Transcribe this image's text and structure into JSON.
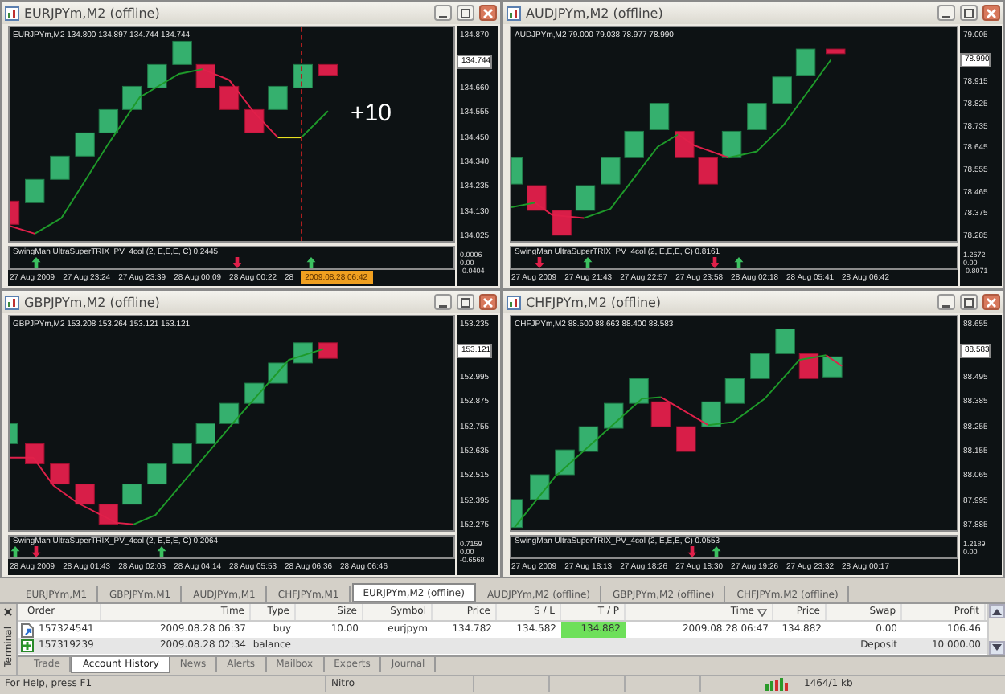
{
  "windows": [
    {
      "title": "EURJPYm,M2 (offline)",
      "info": "EURJPYm,M2  134.800 134.897 134.744 134.744",
      "annotation": "+10",
      "prices": [
        {
          "text": "134.870",
          "current": false
        },
        {
          "text": "134.744",
          "current": true
        },
        {
          "text": "134.660",
          "current": false
        },
        {
          "text": "134.555",
          "current": false
        },
        {
          "text": "134.450",
          "current": false
        },
        {
          "text": "134.340",
          "current": false
        },
        {
          "text": "134.235",
          "current": false
        },
        {
          "text": "134.130",
          "current": false
        },
        {
          "text": "134.025",
          "current": false
        }
      ],
      "indicator": "SwingMan UltraSuperTRIX_PV_4col (2, E,E,E, C) 0.2445",
      "indicator_scale": [
        "0.0006",
        "0.00",
        "-0.0404"
      ],
      "times": [
        "27 Aug 2009",
        "27 Aug 23:24",
        "27 Aug 23:39",
        "28 Aug 00:09",
        "28 Aug 00:22",
        "28"
      ],
      "cursor_time": "2009.08.28 06:42"
    },
    {
      "title": "AUDJPYm,M2 (offline)",
      "info": "AUDJPYm,M2  79.000 79.038 78.977 78.990",
      "prices": [
        {
          "text": "79.005",
          "current": false
        },
        {
          "text": "78.990",
          "current": true
        },
        {
          "text": "78.915",
          "current": false
        },
        {
          "text": "78.825",
          "current": false
        },
        {
          "text": "78.735",
          "current": false
        },
        {
          "text": "78.645",
          "current": false
        },
        {
          "text": "78.555",
          "current": false
        },
        {
          "text": "78.465",
          "current": false
        },
        {
          "text": "78.375",
          "current": false
        },
        {
          "text": "78.285",
          "current": false
        }
      ],
      "indicator": "SwingMan UltraSuperTRIX_PV_4col (2, E,E,E, C) 0.8161",
      "indicator_scale": [
        "1.2672",
        "0.00",
        "-0.8071"
      ],
      "times": [
        "27 Aug 2009",
        "27 Aug 21:43",
        "27 Aug 22:57",
        "27 Aug 23:58",
        "28 Aug 02:18",
        "28 Aug 05:41",
        "28 Aug 06:42"
      ]
    },
    {
      "title": "GBPJPYm,M2 (offline)",
      "info": "GBPJPYm,M2  153.208 153.264 153.121 153.121",
      "prices": [
        {
          "text": "153.235",
          "current": false
        },
        {
          "text": "153.121",
          "current": true
        },
        {
          "text": "152.995",
          "current": false
        },
        {
          "text": "152.875",
          "current": false
        },
        {
          "text": "152.755",
          "current": false
        },
        {
          "text": "152.635",
          "current": false
        },
        {
          "text": "152.515",
          "current": false
        },
        {
          "text": "152.395",
          "current": false
        },
        {
          "text": "152.275",
          "current": false
        }
      ],
      "indicator": "SwingMan UltraSuperTRIX_PV_4col (2, E,E,E, C) 0.2064",
      "indicator_scale": [
        "0.7159",
        "0.00",
        "-0.6568"
      ],
      "times": [
        "28 Aug 2009",
        "28 Aug 01:43",
        "28 Aug 02:03",
        "28 Aug 04:14",
        "28 Aug 05:53",
        "28 Aug 06:36",
        "28 Aug 06:46"
      ]
    },
    {
      "title": "CHFJPYm,M2 (offline)",
      "info": "CHFJPYm,M2  88.500 88.663 88.400 88.583",
      "prices": [
        {
          "text": "88.655",
          "current": false
        },
        {
          "text": "88.583",
          "current": true
        },
        {
          "text": "88.495",
          "current": false
        },
        {
          "text": "88.385",
          "current": false
        },
        {
          "text": "88.255",
          "current": false
        },
        {
          "text": "88.155",
          "current": false
        },
        {
          "text": "88.065",
          "current": false
        },
        {
          "text": "87.995",
          "current": false
        },
        {
          "text": "87.885",
          "current": false
        }
      ],
      "indicator": "SwingMan UltraSuperTRIX_PV_4col (2, E,E,E, C) 0.0553",
      "indicator_scale": [
        "1.2189",
        "0.00"
      ],
      "times": [
        "27 Aug 2009",
        "27 Aug 18:13",
        "27 Aug 18:26",
        "27 Aug 18:30",
        "27 Aug 19:26",
        "27 Aug 23:32",
        "28 Aug 00:17"
      ]
    }
  ],
  "chart_tabs": [
    {
      "label": "EURJPYm,M1",
      "selected": false
    },
    {
      "label": "GBPJPYm,M1",
      "selected": false
    },
    {
      "label": "AUDJPYm,M1",
      "selected": false
    },
    {
      "label": "CHFJPYm,M1",
      "selected": false
    },
    {
      "label": "EURJPYm,M2 (offline)",
      "selected": true
    },
    {
      "label": "AUDJPYm,M2 (offline)",
      "selected": false
    },
    {
      "label": "GBPJPYm,M2 (offline)",
      "selected": false
    },
    {
      "label": "CHFJPYm,M2 (offline)",
      "selected": false
    }
  ],
  "terminal": {
    "label": "Terminal",
    "columns": [
      {
        "label": "Order",
        "sorted": false
      },
      {
        "label": "Time",
        "sorted": false
      },
      {
        "label": "Type",
        "sorted": false
      },
      {
        "label": "Size",
        "sorted": false
      },
      {
        "label": "Symbol",
        "sorted": false
      },
      {
        "label": "Price",
        "sorted": false
      },
      {
        "label": "S / L",
        "sorted": false
      },
      {
        "label": "T / P",
        "sorted": false
      },
      {
        "label": "Time",
        "sorted": true
      },
      {
        "label": "Price",
        "sorted": false
      },
      {
        "label": "Swap",
        "sorted": false
      },
      {
        "label": "Profit",
        "sorted": false
      }
    ],
    "rows": [
      {
        "kind": "trade",
        "order": "157324541",
        "open_time": "2009.08.28 06:37",
        "type": "buy",
        "size": "10.00",
        "symbol": "eurjpym",
        "price": "134.782",
        "sl": "134.582",
        "tp": "134.882",
        "tp_hit": true,
        "close_time": "2009.08.28 06:47",
        "close_price": "134.882",
        "swap": "0.00",
        "profit": "106.46"
      },
      {
        "kind": "balance",
        "order": "157319239",
        "open_time": "2009.08.28 02:34",
        "type": "balance",
        "comment": "Deposit",
        "profit": "10 000.00"
      }
    ],
    "tabs": [
      {
        "label": "Trade",
        "selected": false
      },
      {
        "label": "Account History",
        "selected": true
      },
      {
        "label": "News",
        "selected": false
      },
      {
        "label": "Alerts",
        "selected": false
      },
      {
        "label": "Mailbox",
        "selected": false
      },
      {
        "label": "Experts",
        "selected": false
      },
      {
        "label": "Journal",
        "selected": false
      }
    ]
  },
  "status_bar": {
    "help": "For Help, press F1",
    "profile": "Nitro",
    "traffic": "1464/1 kb"
  }
}
